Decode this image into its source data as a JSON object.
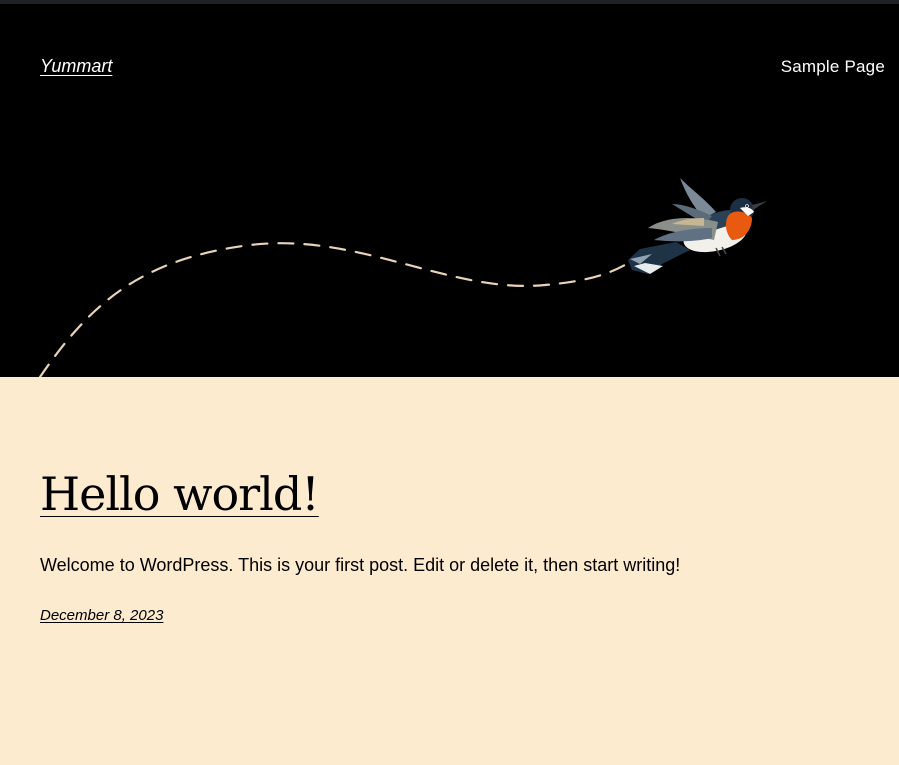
{
  "site": {
    "title": "Yummart"
  },
  "navigation": {
    "items": [
      {
        "label": "Sample Page"
      }
    ]
  },
  "header_art": {
    "icon": "bird-icon",
    "trail_color": "#e8d3b8",
    "background": "#000000"
  },
  "post": {
    "title": "Hello world!",
    "excerpt": "Welcome to WordPress. This is your first post. Edit or delete it, then start writing!",
    "date": "December 8, 2023"
  },
  "colors": {
    "page_background": "#fdebd0",
    "header_background": "#000000",
    "text": "#000000",
    "header_text": "#ffffff"
  }
}
